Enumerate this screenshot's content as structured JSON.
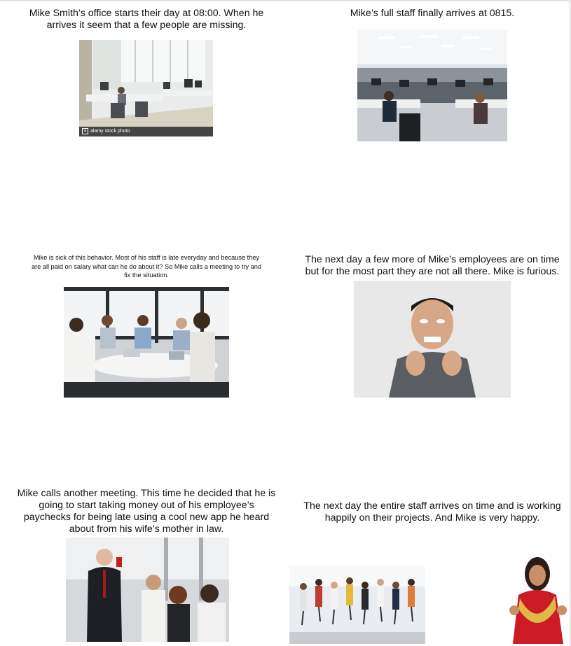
{
  "panels": {
    "p1": {
      "line1": "Mike Smith’s office starts their day at 08:00. When he",
      "line2": "arrives it seem that a few people are missing.",
      "watermark_mark": "a",
      "watermark_text": "alamy stock photo"
    },
    "p2": {
      "line1": "Mike’s full staff finally arrives at 0815."
    },
    "p3": {
      "line1": "Mike is sick of this behavior. Most of his staff is late everyday and because they",
      "line2": "are all paid on salary what can he do about it? So Mike calls a meeting to try and",
      "line3": "fix the situation."
    },
    "p4": {
      "line1": "The next day a few more of Mike’s employees are on time",
      "line2": "but for the most part they are not all there. Mike is furious."
    },
    "p5": {
      "line1": "Mike calls another meeting. This time he decided that he is",
      "line2": "going to start taking money out of his employee’s",
      "line3": "paychecks for being late using a cool new app he heard",
      "line4": "about from his wife’s mother in law."
    },
    "p6": {
      "line1": "The next day the entire staff arrives on time and is working",
      "line2": "happily on their projects. And Mike is very happy."
    }
  },
  "colors": {
    "text": "#111111",
    "background": "#ffffff"
  }
}
